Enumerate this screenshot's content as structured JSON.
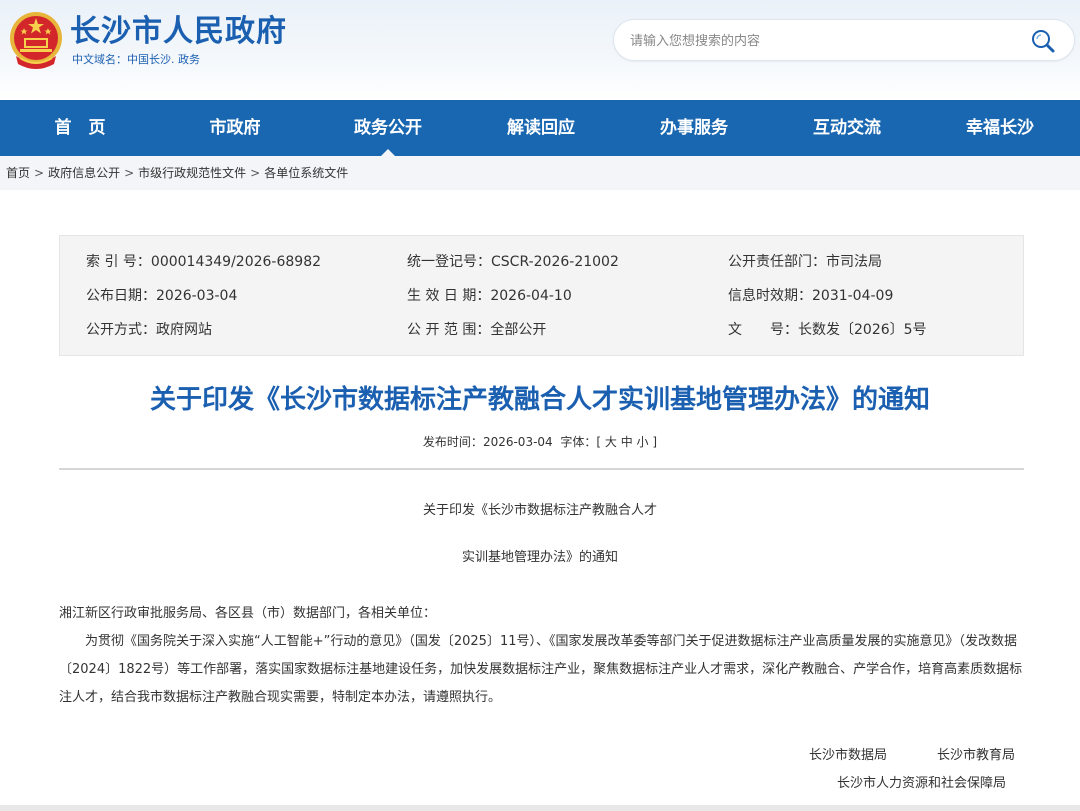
{
  "header": {
    "site_title": "长沙市人民政府",
    "site_domain": "中文域名：中国长沙. 政务",
    "search_placeholder": "请输入您想搜索的内容",
    "brand_color": "#1b5fb0"
  },
  "nav": {
    "items": [
      {
        "label": "首　页"
      },
      {
        "label": "市政府"
      },
      {
        "label": "政务公开",
        "active": true
      },
      {
        "label": "解读回应"
      },
      {
        "label": "办事服务"
      },
      {
        "label": "互动交流"
      },
      {
        "label": "幸福长沙"
      }
    ],
    "bg_color": "#1a67b1"
  },
  "breadcrumb": {
    "items": [
      "首页",
      "政府信息公开",
      "市级行政规范性文件",
      "各单位系统文件"
    ],
    "separator": ">"
  },
  "meta": {
    "index_no": {
      "label": "索 引 号：",
      "value": "000014349/2026-68982"
    },
    "reg_no": {
      "label": "统一登记号：",
      "value": "CSCR-2026-21002"
    },
    "dept": {
      "label": "公开责任部门：",
      "value": "市司法局"
    },
    "pub_date": {
      "label": "公布日期：",
      "value": "2026-03-04"
    },
    "eff_date": {
      "label": "生 效 日 期：",
      "value": "2026-04-10"
    },
    "valid_date": {
      "label": "信息时效期：",
      "value": "2031-04-09"
    },
    "pub_method": {
      "label": "公开方式：",
      "value": "政府网站"
    },
    "pub_scope": {
      "label": "公 开 范 围：",
      "value": "全部公开"
    },
    "doc_no": {
      "label": "文　　号：",
      "value": "长数发〔2026〕5号"
    }
  },
  "document": {
    "title": "关于印发《长沙市数据标注产教融合人才实训基地管理办法》的通知",
    "publish_label": "发布时间：",
    "publish_time": "2026-03-04",
    "font_label": "字体：",
    "font_open": "[",
    "font_large": "大",
    "font_medium": "中",
    "font_small": "小",
    "font_close": "]",
    "subtitle_line1": "关于印发《长沙市数据标注产教融合人才",
    "subtitle_line2": "实训基地管理办法》的通知",
    "salutation": "湘江新区行政审批服务局、各区县（市）数据部门，各相关单位：",
    "body": "为贯彻《国务院关于深入实施“人工智能+”行动的意见》（国发〔2025〕11号）、《国家发展改革委等部门关于促进数据标注产业高质量发展的实施意见》（发改数据〔2024〕1822号）等工作部署，落实国家数据标注基地建设任务，加快发展数据标注产业，聚焦数据标注产业人才需求，深化产教融合、产学合作，培育高素质数据标注人才，结合我市数据标注产教融合现实需要，特制定本办法，请遵照执行。",
    "signers": {
      "s1": "长沙市数据局",
      "s2": "长沙市教育局",
      "s3": "长沙市人力资源和社会保障局"
    }
  }
}
